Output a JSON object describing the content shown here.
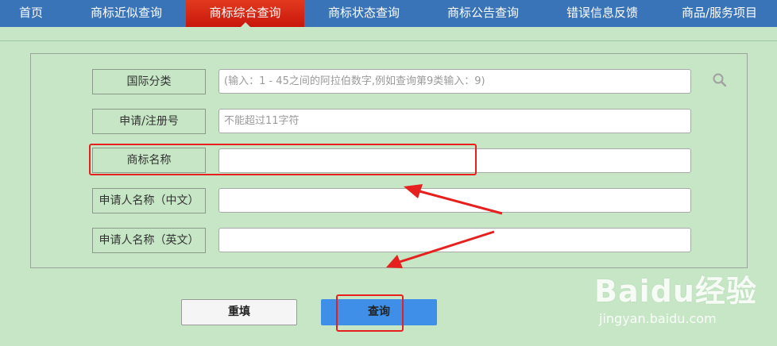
{
  "nav": {
    "items": [
      {
        "label": "首页"
      },
      {
        "label": "商标近似查询"
      },
      {
        "label": "商标综合查询",
        "active": true
      },
      {
        "label": "商标状态查询"
      },
      {
        "label": "商标公告查询"
      },
      {
        "label": "错误信息反馈"
      },
      {
        "label": "商品/服务项目"
      }
    ]
  },
  "form": {
    "fields": [
      {
        "label": "国际分类",
        "value": "",
        "placeholder": "(输入：1 - 45之间的阿拉伯数字,例如查询第9类输入：9)"
      },
      {
        "label": "申请/注册号",
        "value": "",
        "placeholder": "不能超过11字符"
      },
      {
        "label": "商标名称",
        "value": "",
        "placeholder": ""
      },
      {
        "label": "申请人名称（中文）",
        "value": "",
        "placeholder": ""
      },
      {
        "label": "申请人名称（英文）",
        "value": "",
        "placeholder": ""
      }
    ],
    "search_icon": "search-icon"
  },
  "buttons": {
    "reset_label": "重填",
    "query_label": "查询"
  },
  "watermark": {
    "logo_text": "Baidu经验",
    "url": "jingyan.baidu.com"
  },
  "colors": {
    "nav_bg": "#3a74b8",
    "nav_active": "#d8241a",
    "page_bg": "#c6e6c6",
    "query_button": "#3f8fe9",
    "annotation_red": "#e6201e"
  }
}
